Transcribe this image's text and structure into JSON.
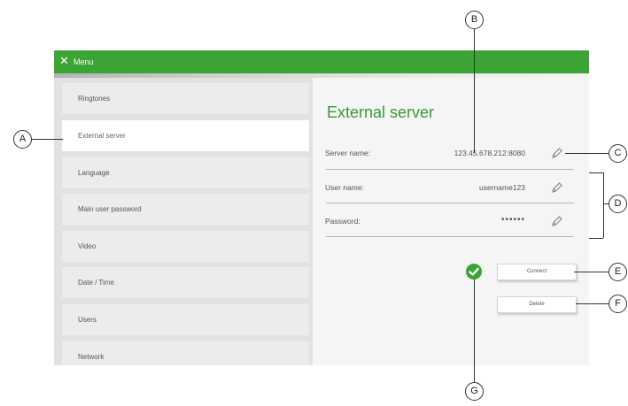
{
  "menubar": {
    "title": "Menu",
    "close_icon": "close-icon"
  },
  "sidebar": {
    "items": [
      {
        "label": "Ringtones"
      },
      {
        "label": "External server"
      },
      {
        "label": "Language"
      },
      {
        "label": "Main user password"
      },
      {
        "label": "Video"
      },
      {
        "label": "Date / Time"
      },
      {
        "label": "Users"
      },
      {
        "label": "Network"
      }
    ],
    "selected": "External server"
  },
  "panel": {
    "heading": "External server",
    "fields": [
      {
        "label": "Server name:",
        "value": "123.45.678.212:8080"
      },
      {
        "label": "User name:",
        "value": "username123"
      },
      {
        "label": "Password:",
        "value": "••••••"
      }
    ],
    "connect_label": "Connect",
    "delete_label": "Delete"
  },
  "callouts": {
    "a": "A",
    "b": "B",
    "c": "C",
    "d": "D",
    "e": "E",
    "f": "F",
    "g": "G"
  },
  "colors": {
    "accent": "#3ca435",
    "heading": "#3a9a35"
  }
}
